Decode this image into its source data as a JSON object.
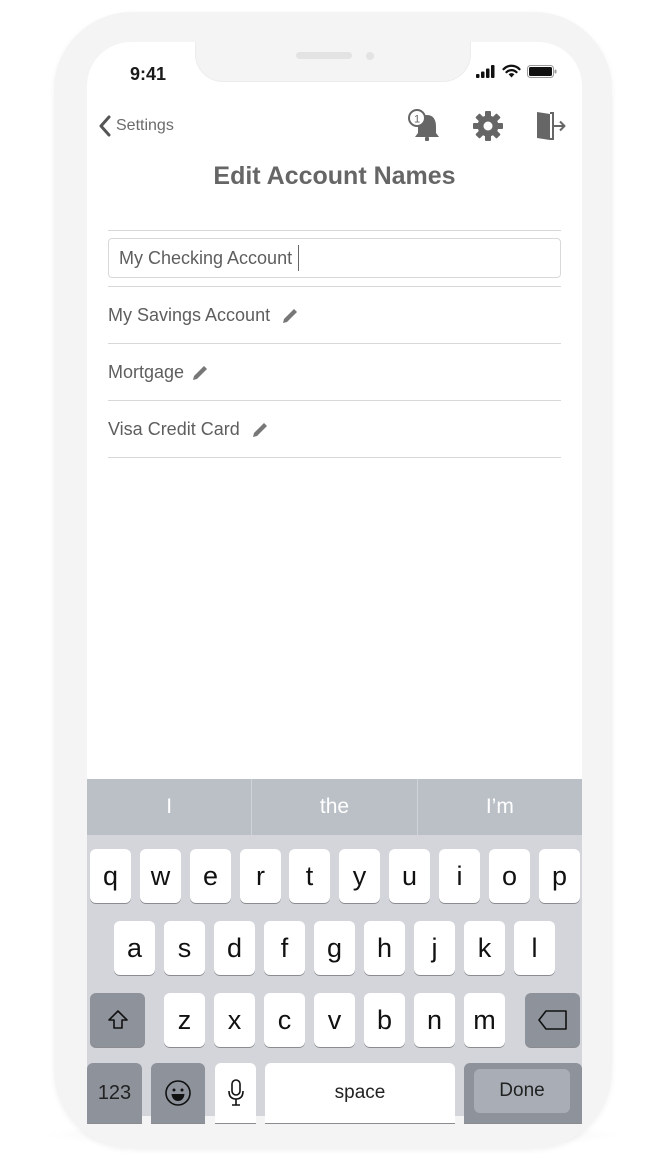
{
  "status_bar": {
    "time": "9:41",
    "icons": [
      "signal-icon",
      "wifi-icon",
      "battery-icon"
    ]
  },
  "nav": {
    "back_label": "Settings",
    "notification_badge": "1",
    "icons": [
      "bell-icon",
      "gear-icon",
      "logout-door-icon"
    ]
  },
  "page": {
    "title": "Edit Account Names"
  },
  "editing_field": {
    "value": "My Checking Account"
  },
  "accounts": [
    {
      "name": "My Savings Account",
      "icon": "pencil-icon"
    },
    {
      "name": "Mortgage",
      "icon": "pencil-icon"
    },
    {
      "name": "Visa Credit Card",
      "icon": "pencil-icon"
    }
  ],
  "keyboard": {
    "suggestions": [
      "I",
      "the",
      "I’m"
    ],
    "row1": [
      "q",
      "w",
      "e",
      "r",
      "t",
      "y",
      "u",
      "i",
      "o",
      "p"
    ],
    "row2": [
      "a",
      "s",
      "d",
      "f",
      "g",
      "h",
      "j",
      "k",
      "l"
    ],
    "row3": [
      "z",
      "x",
      "c",
      "v",
      "b",
      "n",
      "m"
    ],
    "numbers_label": "123",
    "space_label": "space",
    "done_label": "Done"
  }
}
